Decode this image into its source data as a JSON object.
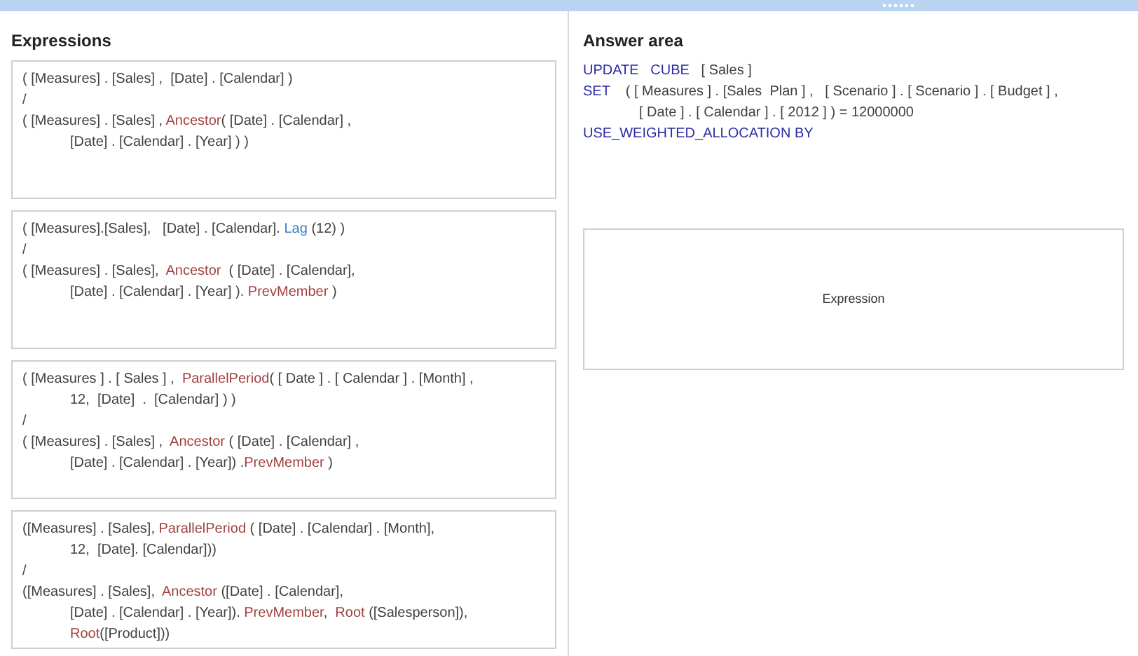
{
  "expressions": {
    "title": "Expressions",
    "cards": [
      {
        "lines": [
          {
            "indented": false,
            "segments": [
              {
                "kind": "plain",
                "text": "( [Measures] . [Sales] ,  [Date] . [Calendar] )"
              }
            ]
          },
          {
            "indented": false,
            "segments": [
              {
                "kind": "plain",
                "text": "/"
              }
            ]
          },
          {
            "indented": false,
            "segments": [
              {
                "kind": "plain",
                "text": "( [Measures] . [Sales] , "
              },
              {
                "kind": "function",
                "text": "Ancestor"
              },
              {
                "kind": "plain",
                "text": "( [Date] . [Calendar] ,"
              }
            ]
          },
          {
            "indented": true,
            "segments": [
              {
                "kind": "plain",
                "text": "[Date] . [Calendar] . [Year] ) )"
              }
            ]
          }
        ]
      },
      {
        "lines": [
          {
            "indented": false,
            "segments": [
              {
                "kind": "plain",
                "text": "( [Measures].[Sales],   [Date] . [Calendar]. "
              },
              {
                "kind": "member",
                "text": "Lag"
              },
              {
                "kind": "plain",
                "text": " (12) )"
              }
            ]
          },
          {
            "indented": false,
            "segments": [
              {
                "kind": "plain",
                "text": "/"
              }
            ]
          },
          {
            "indented": false,
            "segments": [
              {
                "kind": "plain",
                "text": "( [Measures] . [Sales],  "
              },
              {
                "kind": "function",
                "text": "Ancestor"
              },
              {
                "kind": "plain",
                "text": "  ( [Date] . [Calendar],"
              }
            ]
          },
          {
            "indented": true,
            "segments": [
              {
                "kind": "plain",
                "text": "[Date] . [Calendar] . [Year] ). "
              },
              {
                "kind": "function",
                "text": "PrevMember"
              },
              {
                "kind": "plain",
                "text": " )"
              }
            ]
          }
        ]
      },
      {
        "lines": [
          {
            "indented": false,
            "segments": [
              {
                "kind": "plain",
                "text": "( [Measures ] . [ Sales ] ,  "
              },
              {
                "kind": "function",
                "text": "ParallelPeriod"
              },
              {
                "kind": "plain",
                "text": "( [ Date ] . [ Calendar ] . [Month] ,"
              }
            ]
          },
          {
            "indented": true,
            "segments": [
              {
                "kind": "plain",
                "text": "12,  [Date]  .  [Calendar] ) )"
              }
            ]
          },
          {
            "indented": false,
            "segments": [
              {
                "kind": "plain",
                "text": "/"
              }
            ]
          },
          {
            "indented": false,
            "segments": [
              {
                "kind": "plain",
                "text": "( [Measures] . [Sales] ,  "
              },
              {
                "kind": "function",
                "text": "Ancestor"
              },
              {
                "kind": "plain",
                "text": " ( [Date] . [Calendar] ,"
              }
            ]
          },
          {
            "indented": true,
            "segments": [
              {
                "kind": "plain",
                "text": "[Date] . [Calendar] . [Year]) ."
              },
              {
                "kind": "function",
                "text": "PrevMember"
              },
              {
                "kind": "plain",
                "text": " )"
              }
            ]
          }
        ]
      },
      {
        "lines": [
          {
            "indented": false,
            "segments": [
              {
                "kind": "plain",
                "text": "([Measures] . [Sales], "
              },
              {
                "kind": "function",
                "text": "ParallelPeriod"
              },
              {
                "kind": "plain",
                "text": " ( [Date] . [Calendar] . [Month],"
              }
            ]
          },
          {
            "indented": true,
            "segments": [
              {
                "kind": "plain",
                "text": "12,  [Date]. [Calendar]))"
              }
            ]
          },
          {
            "indented": false,
            "segments": [
              {
                "kind": "plain",
                "text": "/"
              }
            ]
          },
          {
            "indented": false,
            "segments": [
              {
                "kind": "plain",
                "text": "([Measures] . [Sales],  "
              },
              {
                "kind": "function",
                "text": "Ancestor"
              },
              {
                "kind": "plain",
                "text": " ([Date] . [Calendar],"
              }
            ]
          },
          {
            "indented": true,
            "segments": [
              {
                "kind": "plain",
                "text": "[Date] . [Calendar] . [Year]). "
              },
              {
                "kind": "function",
                "text": "PrevMember"
              },
              {
                "kind": "plain",
                "text": ",  "
              },
              {
                "kind": "function",
                "text": "Root"
              },
              {
                "kind": "plain",
                "text": " ([Salesperson]),"
              }
            ]
          },
          {
            "indented": true,
            "segments": [
              {
                "kind": "function",
                "text": "Root"
              },
              {
                "kind": "plain",
                "text": "([Product]))"
              }
            ]
          }
        ]
      }
    ]
  },
  "answer_area": {
    "title": "Answer area",
    "lines": [
      {
        "indented": false,
        "segments": [
          {
            "kind": "keyword",
            "text": "UPDATE   CUBE"
          },
          {
            "kind": "plain",
            "text": "   [ Sales ]"
          }
        ]
      },
      {
        "indented": false,
        "segments": [
          {
            "kind": "keyword",
            "text": "SET"
          },
          {
            "kind": "plain",
            "text": "    ( [ Measures ] . [Sales  Plan ] ,   [ Scenario ] . [ Scenario ] . [ Budget ] ,"
          }
        ]
      },
      {
        "indented": true,
        "segments": [
          {
            "kind": "plain",
            "text": "[ Date ] . [ Calendar ] . [ 2012 ] ) = 12000000"
          }
        ]
      },
      {
        "indented": false,
        "segments": [
          {
            "kind": "keyword",
            "text": "USE_WEIGHTED_ALLOCATION BY"
          }
        ]
      }
    ],
    "drop_zone": {
      "label": "Expression"
    }
  }
}
